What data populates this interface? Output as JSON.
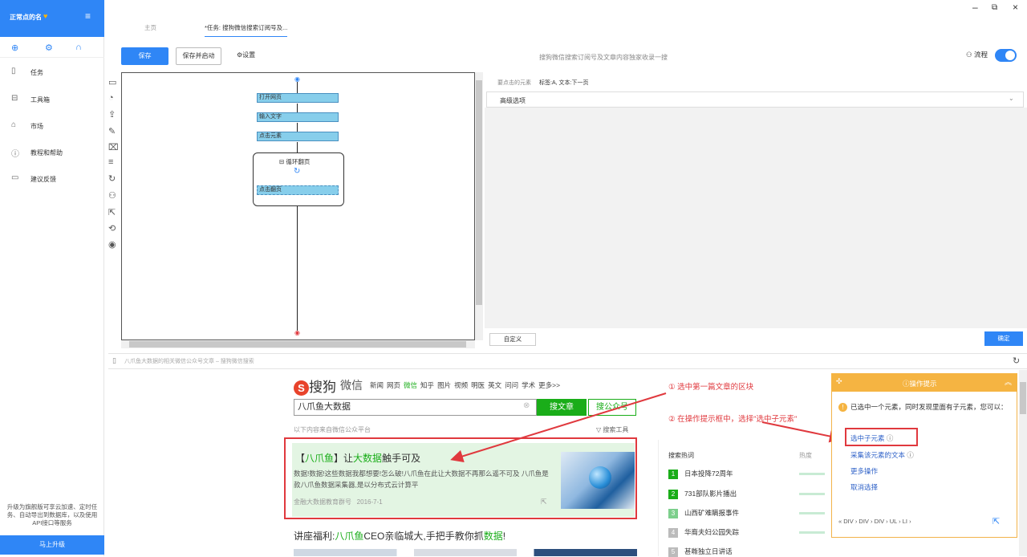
{
  "sidebar": {
    "title": "正常点的名",
    "nav": [
      {
        "icon": "file-icon",
        "label": "任务"
      },
      {
        "icon": "toolbox-icon",
        "label": "工具箱"
      },
      {
        "icon": "market-icon",
        "label": "市场"
      },
      {
        "icon": "help-icon",
        "label": "教程和帮助"
      },
      {
        "icon": "feedback-icon",
        "label": "建议反馈"
      }
    ],
    "promo": "升级为旗舰版可享云加速、定时任务、自动导出到数据库，以及使用API接口等服务",
    "upgrade": "马上升级"
  },
  "tabs": [
    "主页",
    "*任务: 搜狗微信搜索订阅号及..."
  ],
  "toolbar": {
    "save": "保存",
    "save_run": "保存并启动",
    "settings": "设置",
    "center": "搜狗微信搜索订阅号及文章内容独家收录一搜",
    "flow": "流程",
    "flow_on": true
  },
  "flow": {
    "nodes": [
      "打开网页",
      "输入文字",
      "点击元素"
    ],
    "loop": "循环翻页",
    "loop_node": "点击翻页"
  },
  "right_panel": {
    "label": "要点击的元素",
    "value": "标签:A, 文本:下一页",
    "advanced": "高级选项",
    "custom": "自定义",
    "ok": "确定"
  },
  "browser": {
    "url": "八爪鱼大数据的相关微信公众号文章 – 搜狗微信搜索"
  },
  "web": {
    "logo": "搜狗",
    "logo_sub": "微信",
    "nav": [
      "新闻",
      "网页",
      "微信",
      "知乎",
      "图片",
      "视频",
      "明医",
      "英文",
      "问问",
      "学术",
      "更多>>"
    ],
    "nav_active": "微信",
    "search_value": "八爪鱼大数据",
    "btn_article": "搜文章",
    "btn_account": "搜公众号",
    "source_note": "以下内容来自微信公众平台",
    "tools": "搜索工具",
    "result": {
      "title_parts": [
        "【",
        "八爪鱼",
        "】让",
        "大数据",
        "触手可及"
      ],
      "desc": "数据!数据!这些数据我都想要!怎么破!八爪鱼在此让大数据不再那么遥不可及 八爪鱼是款八爪鱼数据采集器,是以分布式云计算平",
      "source": "金融大数据教育群号",
      "date": "2016-7-1"
    },
    "result2_parts": [
      "讲座福利:",
      "八爪鱼",
      "CEO亲临城大,手把手教你抓",
      "数据",
      "!"
    ],
    "hot_title": "搜索热词",
    "hot_col": "热度",
    "hot": [
      {
        "rank": "1",
        "text": "日本投降72周年"
      },
      {
        "rank": "2",
        "text": "731部队影片播出"
      },
      {
        "rank": "3",
        "text": "山西矿难瞒报事件"
      },
      {
        "rank": "4",
        "text": "华裔夫妇公园失踪"
      },
      {
        "rank": "5",
        "text": "甚嘶独立日讲话"
      }
    ]
  },
  "annotations": {
    "a1": "① 选中第一篇文章的区块",
    "a2": "② 在操作提示框中，选择\"选中子元素\""
  },
  "tip": {
    "title": "操作提示",
    "body": "已选中一个元素，同时发现里面有子元素，您可以：",
    "links": [
      "选中子元素",
      "采集该元素的文本",
      "更多操作",
      "取消选择"
    ],
    "path": "« DIV › DIV › DIV › UL › LI ›"
  },
  "colors": {
    "accent": "#2f86f6",
    "green": "#1aad19",
    "annotation": "#e0393e",
    "tip": "#f5b442"
  }
}
